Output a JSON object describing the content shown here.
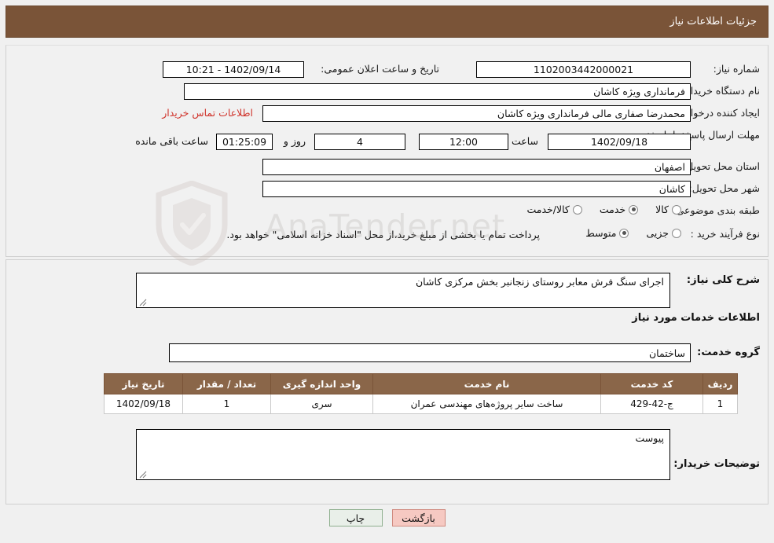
{
  "header": {
    "title": "جزئیات اطلاعات نیاز"
  },
  "form": {
    "need_number_label": "شماره نیاز:",
    "need_number_value": "1102003442000021",
    "announce_datetime_label": "تاریخ و ساعت اعلان عمومی:",
    "announce_datetime_value": "1402/09/14 - 10:21",
    "buyer_org_label": "نام دستگاه خریدار:",
    "buyer_org_value": "فرمانداری ویژه کاشان",
    "requester_label": "ایجاد کننده درخواست:",
    "requester_value": "محمدرضا صفاری مالی فرمانداری ویژه کاشان",
    "contact_link": "اطلاعات تماس خریدار",
    "deadline_label": "مهلت ارسال پاسخ: تا تاریخ:",
    "deadline_date": "1402/09/18",
    "hour_label": "ساعت",
    "deadline_time": "12:00",
    "days_value": "4",
    "days_label": "روز و",
    "countdown_value": "01:25:09",
    "remaining_label": "ساعت باقی مانده",
    "province_label": "استان محل تحویل:",
    "province_value": "اصفهان",
    "city_label": "شهر محل تحویل:",
    "city_value": "کاشان",
    "category_label": "طبقه بندی موضوعی:",
    "category_options": [
      "کالا",
      "خدمت",
      "کالا/خدمت"
    ],
    "category_selected": "خدمت",
    "process_label": "نوع فرآیند خرید :",
    "process_options": [
      "جزیی",
      "متوسط"
    ],
    "process_selected": "متوسط",
    "process_note": "پرداخت تمام یا بخشی از مبلغ خرید،از محل \"اسناد خزانه اسلامی\" خواهد بود."
  },
  "watermark": {
    "text": "AnaTender.net"
  },
  "summary": {
    "label": "شرح کلی نیاز:",
    "value": "اجرای سنگ فرش معابر روستای زنجانبر بخش مرکزی کاشان"
  },
  "services": {
    "section_title": "اطلاعات خدمات مورد نیاز",
    "group_label": "گروه خدمت:",
    "group_value": "ساختمان",
    "columns": [
      "ردیف",
      "کد خدمت",
      "نام خدمت",
      "واحد اندازه گیری",
      "تعداد / مقدار",
      "تاریخ نیاز"
    ],
    "rows": [
      {
        "index": "1",
        "code": "ج-42-429",
        "name": "ساخت سایر پروژه‌های مهندسی عمران",
        "unit": "سری",
        "qty": "1",
        "date": "1402/09/18"
      }
    ]
  },
  "buyer_notes": {
    "label": "توضیحات خریدار:",
    "value": "پیوست"
  },
  "footer": {
    "print_label": "چاپ",
    "back_label": "بازگشت"
  }
}
